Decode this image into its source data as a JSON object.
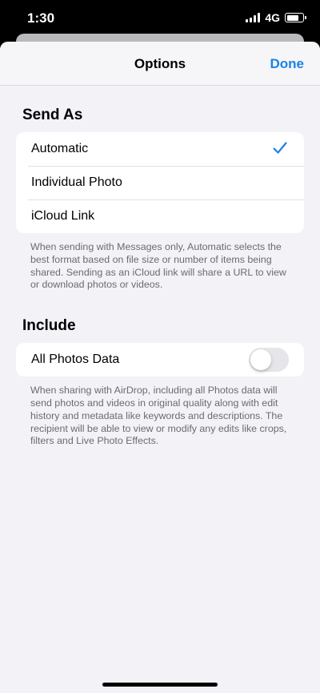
{
  "status_bar": {
    "time": "1:30",
    "network": "4G",
    "battery_level": 0.75
  },
  "nav": {
    "title": "Options",
    "done_label": "Done"
  },
  "send_as": {
    "header": "Send As",
    "options": [
      "Automatic",
      "Individual Photo",
      "iCloud Link"
    ],
    "selected": "Automatic",
    "footnote": "When sending with Messages only, Automatic selects the best format based on file size or number of items being shared. Sending as an iCloud link will share a URL to view or download photos or videos."
  },
  "include": {
    "header": "Include",
    "all_photos_data_label": "All Photos Data",
    "all_photos_data_on": false,
    "footnote": "When sharing with AirDrop, including all Photos data will send photos and videos in original quality along with edit history and metadata like keywords and descriptions. The recipient will be able to view or modify any edits like crops, filters and Live Photo Effects."
  },
  "colors": {
    "accent": "#1a82e8",
    "sheet_bg": "#f2f2f7",
    "toggle_off": "#e5e5ea"
  },
  "icons": {
    "selected_mark": "checkmark-icon",
    "signal": "cellular-signal-icon",
    "battery": "battery-icon"
  }
}
